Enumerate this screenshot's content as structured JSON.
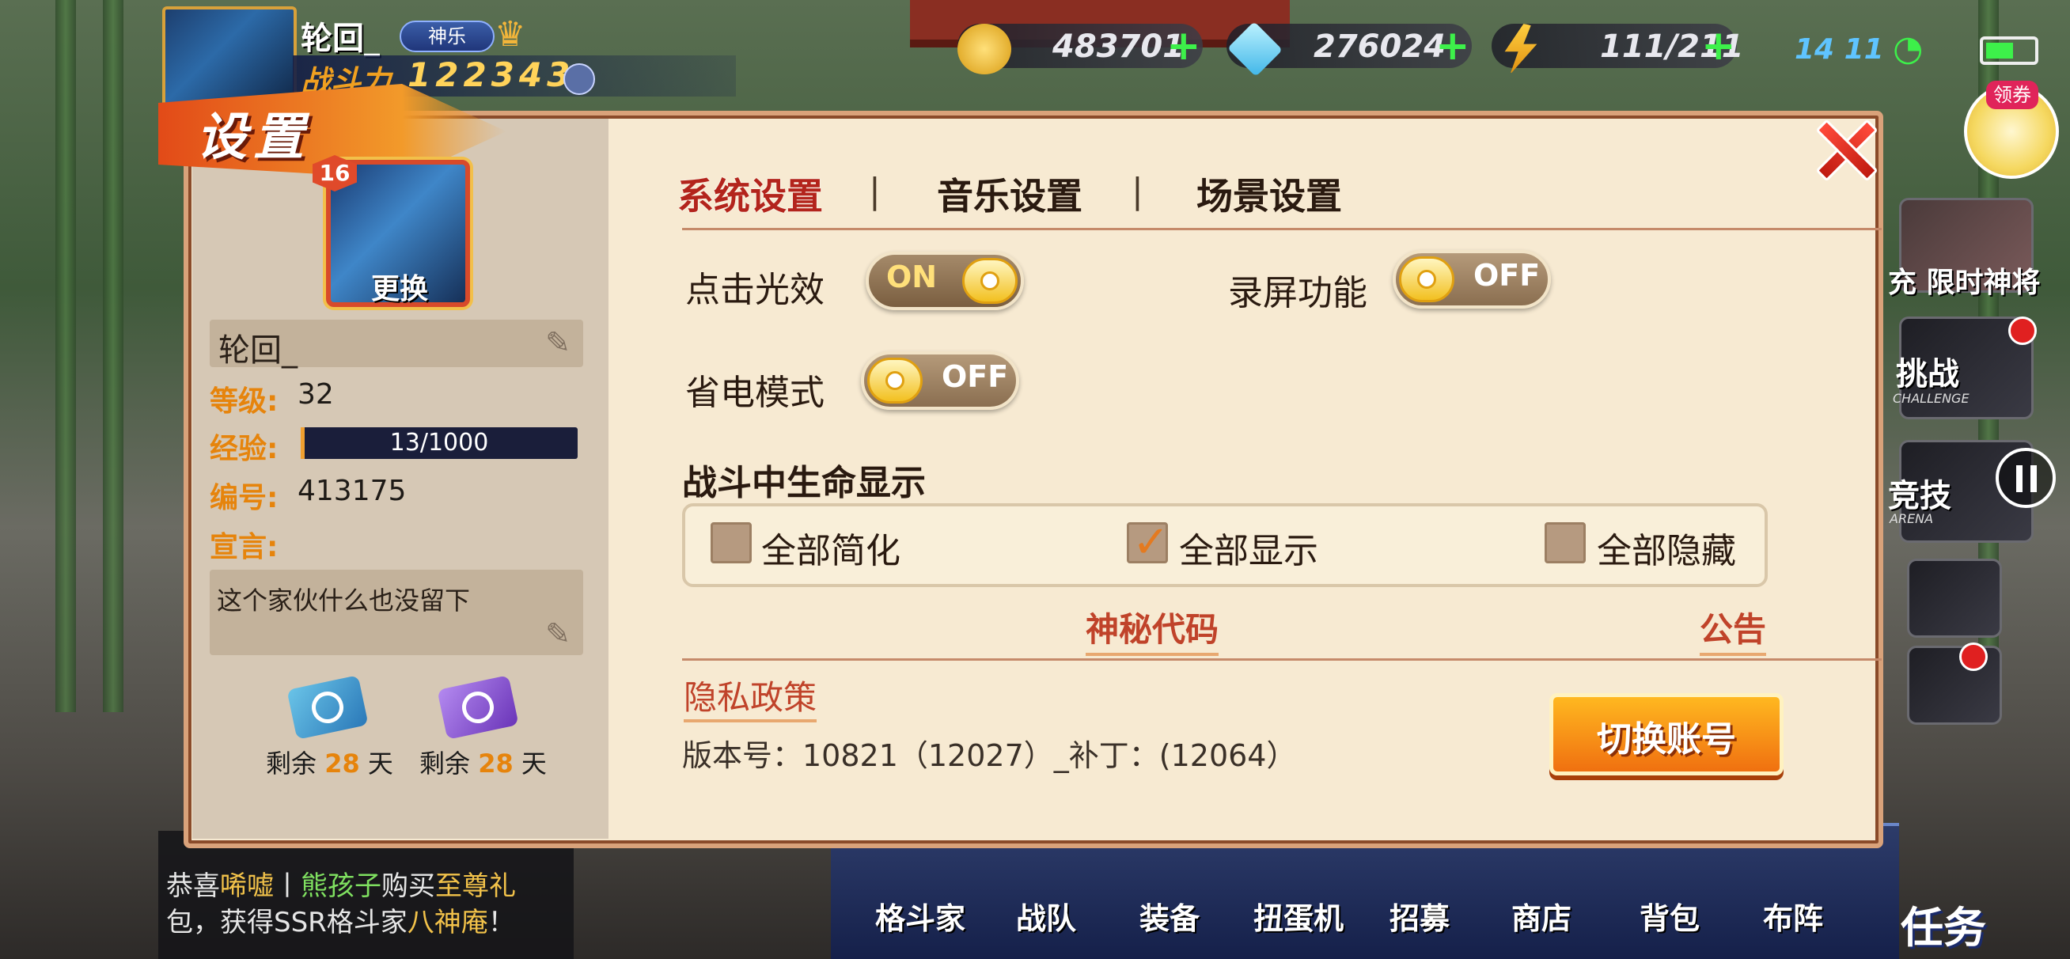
{
  "hud": {
    "player_name": "轮回_",
    "vip_tag": "神乐",
    "power_label": "战斗力",
    "power_value": "122343",
    "gold": "483701",
    "diamonds": "276024",
    "stamina": "111/211",
    "clock": "14 11",
    "coupon_label": "领券"
  },
  "side_buttons": {
    "limited": "充 限时神将",
    "challenge": "挑战",
    "challenge_sub": "CHALLENGE",
    "arena": "竞技",
    "arena_sub": "ARENA"
  },
  "bottom_nav": [
    "格斗家",
    "战队",
    "装备",
    "扭蛋机",
    "招募",
    "商店",
    "背包",
    "布阵"
  ],
  "task_label": "任务",
  "chat": {
    "line1_pre": "恭喜",
    "line1_name": "唏嘘",
    "line1_sep": "丨",
    "line1_name2": "熊孩子",
    "line1_mid": "购买",
    "line1_item": "至尊礼",
    "line2_pre": "包，获得SSR格斗家",
    "line2_item": "八神庵",
    "line2_end": "！"
  },
  "dialog": {
    "title": "设置",
    "profile": {
      "level_badge": "16",
      "change_label": "更换",
      "name": "轮回_",
      "level_label": "等级:",
      "level": "32",
      "exp_label": "经验:",
      "exp": "13/1000",
      "exp_fraction": 0.013,
      "id_label": "编号:",
      "id": "413175",
      "declaration_label": "宣言:",
      "declaration": "这个家伙什么也没留下",
      "remain1_pre": "剩余",
      "remain1_num": "28",
      "remain1_unit": "天",
      "remain2_pre": "剩余",
      "remain2_num": "28",
      "remain2_unit": "天"
    },
    "tabs": [
      "系统设置",
      "音乐设置",
      "场景设置"
    ],
    "tab_separator": "|",
    "options": {
      "click_effect_label": "点击光效",
      "click_effect_state": "ON",
      "record_label": "录屏功能",
      "record_state": "OFF",
      "power_save_label": "省电模式",
      "power_save_state": "OFF"
    },
    "hp_display": {
      "label": "战斗中生命显示",
      "opt1": "全部简化",
      "opt2": "全部显示",
      "opt3": "全部隐藏",
      "checkmark": "✓"
    },
    "links": {
      "secret_code": "神秘代码",
      "notice": "公告",
      "privacy": "隐私政策"
    },
    "version": "版本号：10821（12027）_补丁：(12064）",
    "switch_account": "切换账号",
    "close_glyph": "✕"
  },
  "colors": {
    "accent": "#e6840c",
    "link": "#c0432a",
    "dialog_bg": "#f7ead2"
  },
  "icons": [
    "gold-icon",
    "diamond-icon",
    "stamina-icon",
    "wifi-icon",
    "battery-icon",
    "pencil-icon",
    "close-icon",
    "pause-icon",
    "checkbox-icon"
  ]
}
